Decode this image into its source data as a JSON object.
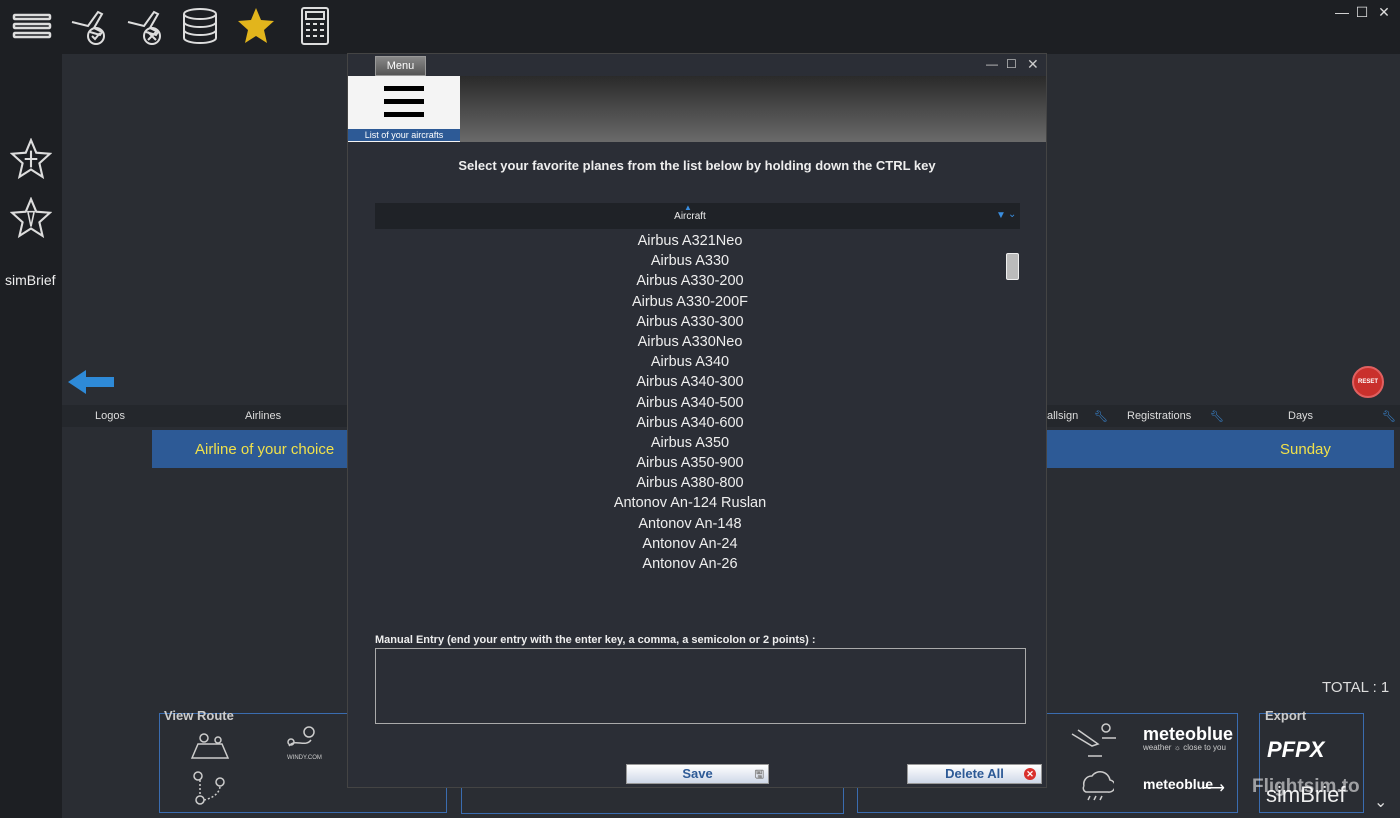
{
  "toolbar": {
    "icons": [
      "menu-icon",
      "plane-check-icon",
      "plane-cancel-icon",
      "database-icon",
      "star-icon",
      "calculator-icon"
    ],
    "window_controls": [
      "minimize",
      "maximize",
      "close"
    ]
  },
  "sidebar": {
    "simbrief_label": "simBrief"
  },
  "table": {
    "columns": [
      "Logos",
      "Airlines",
      "allsign",
      "Registrations",
      "Days"
    ],
    "row": {
      "airline": "Airline of your choice",
      "day": "Sunday"
    },
    "total": "TOTAL : 1"
  },
  "reset_label": "RESET",
  "bottom": {
    "view_route_title": "View Route",
    "windy_label": "WINDY.COM",
    "export_title": "Export",
    "meteoblue_label": "meteoblue",
    "meteoblue_tagline": "weather ☼ close to you",
    "pfpx_label": "PFPX",
    "simbrief_label": "simBrief",
    "watermark": "Flightsim.to"
  },
  "dialog": {
    "menu_tab": "Menu",
    "hamburger_caption": "List of your aircrafts",
    "instruction": "Select your favorite planes from the list below by holding down the CTRL key",
    "list_header": "Aircraft",
    "items": [
      "Airbus A321Neo",
      "Airbus A330",
      "Airbus A330-200",
      "Airbus A330-200F",
      "Airbus A330-300",
      "Airbus A330Neo",
      "Airbus A340",
      "Airbus A340-300",
      "Airbus A340-500",
      "Airbus A340-600",
      "Airbus A350",
      "Airbus A350-900",
      "Airbus A380-800",
      "Antonov An-124 Ruslan",
      "Antonov An-148",
      "Antonov An-24",
      "Antonov An-26"
    ],
    "manual_label": "Manual Entry (end your entry with the enter key, a comma, a semicolon or 2 points) :",
    "manual_value": "",
    "save_label": "Save",
    "delete_label": "Delete All"
  }
}
